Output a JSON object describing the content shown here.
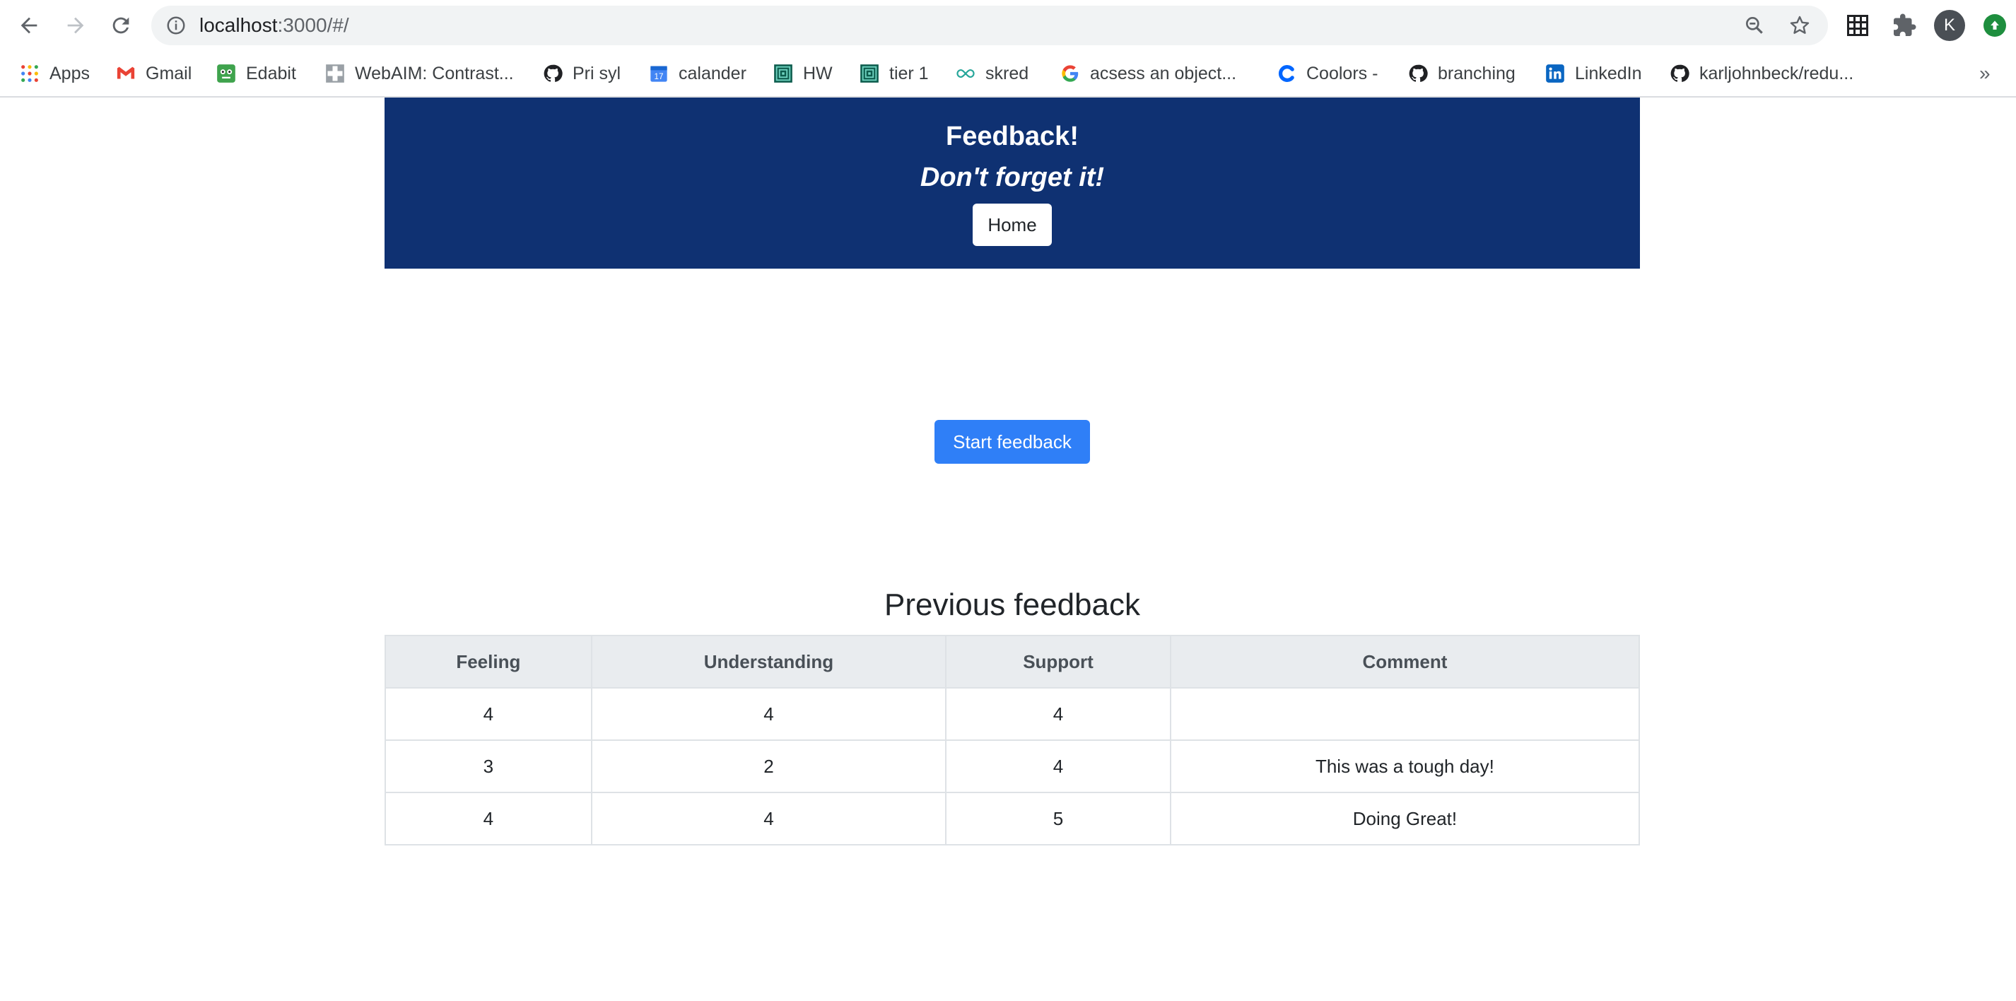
{
  "browser": {
    "url_host": "localhost",
    "url_path": ":3000/#/",
    "avatar_letter": "K",
    "bookmarks": [
      {
        "label": "Apps",
        "icon": "apps-grid-icon"
      },
      {
        "label": "Gmail",
        "icon": "gmail-icon"
      },
      {
        "label": "Edabit",
        "icon": "edabit-icon"
      },
      {
        "label": "WebAIM: Contrast...",
        "icon": "webaim-icon"
      },
      {
        "label": "Pri syl",
        "icon": "github-icon"
      },
      {
        "label": "calander",
        "icon": "calendar-icon"
      },
      {
        "label": "HW",
        "icon": "maze-icon"
      },
      {
        "label": "tier 1",
        "icon": "maze-icon"
      },
      {
        "label": "skred",
        "icon": "infinity-icon"
      },
      {
        "label": "acsess an object...",
        "icon": "google-icon"
      },
      {
        "label": "Coolors -",
        "icon": "coolors-icon"
      },
      {
        "label": "branching",
        "icon": "github-icon"
      },
      {
        "label": "LinkedIn",
        "icon": "linkedin-icon"
      },
      {
        "label": "karljohnbeck/redu...",
        "icon": "github-icon"
      }
    ],
    "more_label": "»",
    "calendar_day": "17"
  },
  "header": {
    "title": "Feedback!",
    "subtitle": "Don't forget it!",
    "home_label": "Home"
  },
  "main": {
    "start_label": "Start feedback",
    "previous_title": "Previous feedback",
    "columns": [
      "Feeling",
      "Understanding",
      "Support",
      "Comment"
    ],
    "rows": [
      [
        "4",
        "4",
        "4",
        ""
      ],
      [
        "3",
        "2",
        "4",
        "This was a tough day!"
      ],
      [
        "4",
        "4",
        "5",
        "Doing Great!"
      ]
    ]
  },
  "colors": {
    "header_bg": "#0f3172",
    "primary_button": "#2f7ff7",
    "table_header_bg": "#e9ecef"
  }
}
